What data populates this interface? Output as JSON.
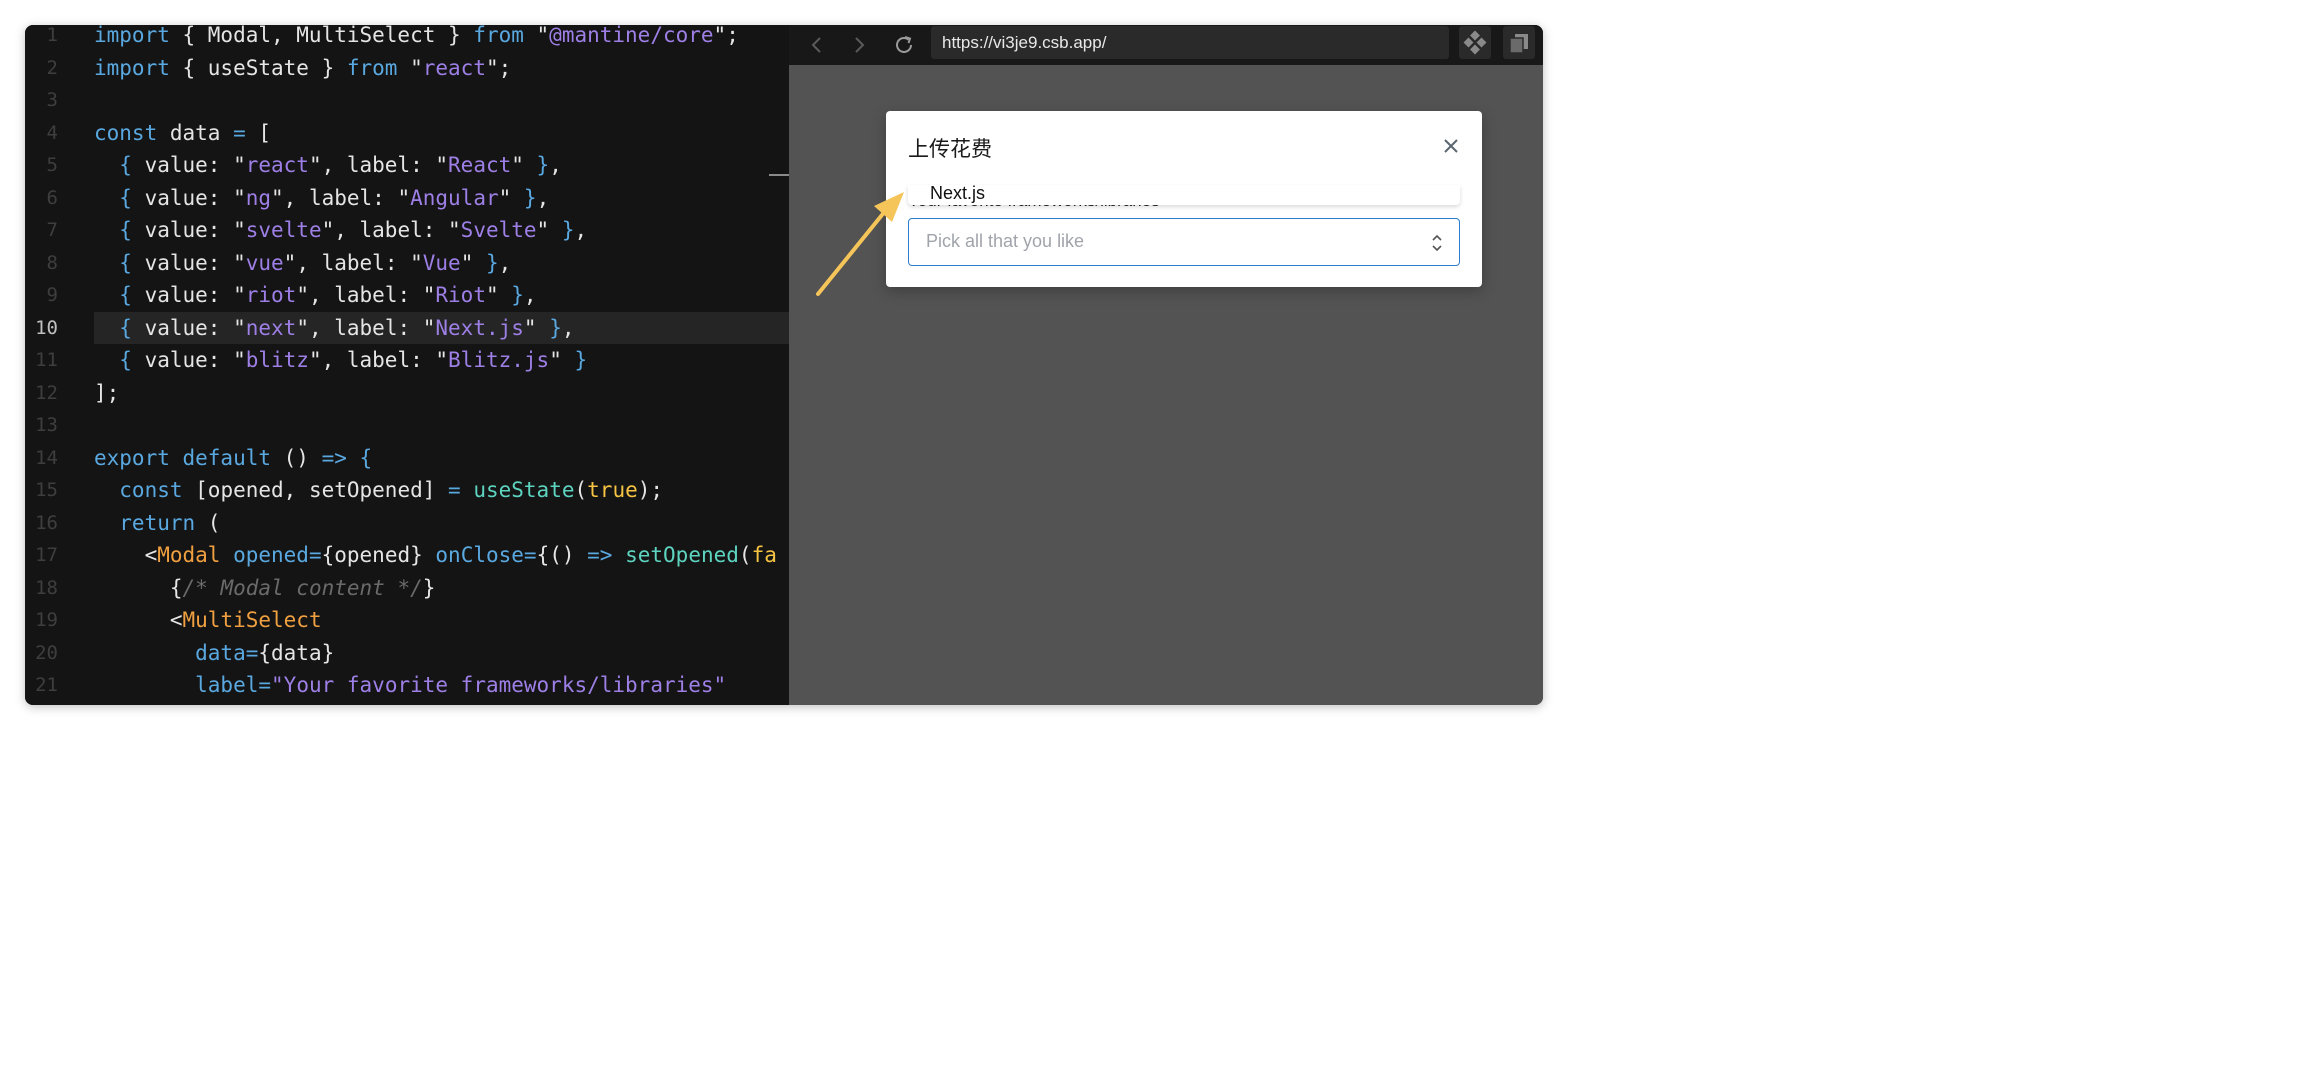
{
  "editor": {
    "active_line": 10,
    "lines": [
      {
        "n": "1",
        "tokens": [
          [
            "kw",
            "import"
          ],
          [
            "punc",
            " { Modal, MultiSelect } "
          ],
          [
            "kw",
            "from"
          ],
          [
            "punc",
            " \""
          ],
          [
            "str",
            "@mantine/core"
          ],
          [
            "punc",
            "\";"
          ]
        ]
      },
      {
        "n": "2",
        "tokens": [
          [
            "kw",
            "import"
          ],
          [
            "punc",
            " { useState } "
          ],
          [
            "kw",
            "from"
          ],
          [
            "punc",
            " \""
          ],
          [
            "str",
            "react"
          ],
          [
            "punc",
            "\";"
          ]
        ]
      },
      {
        "n": "3",
        "tokens": []
      },
      {
        "n": "4",
        "tokens": [
          [
            "kw",
            "const"
          ],
          [
            "punc",
            " data "
          ],
          [
            "kw",
            "="
          ],
          [
            "punc",
            " ["
          ]
        ]
      },
      {
        "n": "5",
        "tokens": [
          [
            "kw",
            "  {"
          ],
          [
            "punc",
            " value: \""
          ],
          [
            "str",
            "react"
          ],
          [
            "punc",
            "\", label: \""
          ],
          [
            "str",
            "React"
          ],
          [
            "punc",
            "\" "
          ],
          [
            "kw",
            "}"
          ],
          [
            "punc",
            ","
          ]
        ]
      },
      {
        "n": "6",
        "tokens": [
          [
            "kw",
            "  {"
          ],
          [
            "punc",
            " value: \""
          ],
          [
            "str",
            "ng"
          ],
          [
            "punc",
            "\", label: \""
          ],
          [
            "str",
            "Angular"
          ],
          [
            "punc",
            "\" "
          ],
          [
            "kw",
            "}"
          ],
          [
            "punc",
            ","
          ]
        ]
      },
      {
        "n": "7",
        "tokens": [
          [
            "kw",
            "  {"
          ],
          [
            "punc",
            " value: \""
          ],
          [
            "str",
            "svelte"
          ],
          [
            "punc",
            "\", label: \""
          ],
          [
            "str",
            "Svelte"
          ],
          [
            "punc",
            "\" "
          ],
          [
            "kw",
            "}"
          ],
          [
            "punc",
            ","
          ]
        ]
      },
      {
        "n": "8",
        "tokens": [
          [
            "kw",
            "  {"
          ],
          [
            "punc",
            " value: \""
          ],
          [
            "str",
            "vue"
          ],
          [
            "punc",
            "\", label: \""
          ],
          [
            "str",
            "Vue"
          ],
          [
            "punc",
            "\" "
          ],
          [
            "kw",
            "}"
          ],
          [
            "punc",
            ","
          ]
        ]
      },
      {
        "n": "9",
        "tokens": [
          [
            "kw",
            "  {"
          ],
          [
            "punc",
            " value: \""
          ],
          [
            "str",
            "riot"
          ],
          [
            "punc",
            "\", label: \""
          ],
          [
            "str",
            "Riot"
          ],
          [
            "punc",
            "\" "
          ],
          [
            "kw",
            "}"
          ],
          [
            "punc",
            ","
          ]
        ]
      },
      {
        "n": "10",
        "tokens": [
          [
            "kw",
            "  {"
          ],
          [
            "punc",
            " value: \""
          ],
          [
            "str",
            "next"
          ],
          [
            "punc",
            "\", label: \""
          ],
          [
            "str",
            "Next.js"
          ],
          [
            "punc",
            "\" "
          ],
          [
            "kw",
            "}"
          ],
          [
            "punc",
            ","
          ]
        ]
      },
      {
        "n": "11",
        "tokens": [
          [
            "kw",
            "  {"
          ],
          [
            "punc",
            " value: \""
          ],
          [
            "str",
            "blitz"
          ],
          [
            "punc",
            "\", label: \""
          ],
          [
            "str",
            "Blitz.js"
          ],
          [
            "punc",
            "\" "
          ],
          [
            "kw",
            "}"
          ]
        ]
      },
      {
        "n": "12",
        "tokens": [
          [
            "punc",
            "];"
          ]
        ]
      },
      {
        "n": "13",
        "tokens": []
      },
      {
        "n": "14",
        "tokens": [
          [
            "kw",
            "export default"
          ],
          [
            "punc",
            " () "
          ],
          [
            "kw",
            "=>"
          ],
          [
            "punc",
            " "
          ],
          [
            "kw",
            "{"
          ]
        ]
      },
      {
        "n": "15",
        "tokens": [
          [
            "kw",
            "  const"
          ],
          [
            "punc",
            " [opened, setOpened] "
          ],
          [
            "kw",
            "="
          ],
          [
            "punc",
            " "
          ],
          [
            "fn",
            "useState"
          ],
          [
            "punc",
            "("
          ],
          [
            "bool",
            "true"
          ],
          [
            "punc",
            ");"
          ]
        ]
      },
      {
        "n": "16",
        "tokens": [
          [
            "kw",
            "  return"
          ],
          [
            "punc",
            " ("
          ]
        ]
      },
      {
        "n": "17",
        "tokens": [
          [
            "punc",
            "    <"
          ],
          [
            "tag",
            "Modal"
          ],
          [
            "punc",
            " "
          ],
          [
            "attr",
            "opened"
          ],
          [
            "kw",
            "="
          ],
          [
            "punc",
            "{opened} "
          ],
          [
            "attr",
            "onClose"
          ],
          [
            "kw",
            "="
          ],
          [
            "punc",
            "{() "
          ],
          [
            "kw",
            "=>"
          ],
          [
            "punc",
            " "
          ],
          [
            "fn",
            "setOpened"
          ],
          [
            "punc",
            "("
          ],
          [
            "bool",
            "fa"
          ]
        ]
      },
      {
        "n": "18",
        "tokens": [
          [
            "punc",
            "      {"
          ],
          [
            "cmt",
            "/* Modal content */"
          ],
          [
            "punc",
            "}"
          ]
        ]
      },
      {
        "n": "19",
        "tokens": [
          [
            "punc",
            "      <"
          ],
          [
            "tag",
            "MultiSelect"
          ]
        ]
      },
      {
        "n": "20",
        "tokens": [
          [
            "attr",
            "        data"
          ],
          [
            "kw",
            "="
          ],
          [
            "punc",
            "{data}"
          ]
        ]
      },
      {
        "n": "21",
        "tokens": [
          [
            "attr",
            "        label"
          ],
          [
            "kw",
            "="
          ],
          [
            "str",
            "\"Your favorite frameworks/libraries\""
          ]
        ]
      }
    ]
  },
  "browser": {
    "back_icon": "chevron-left-icon",
    "forward_icon": "chevron-right-icon",
    "reload_icon": "reload-icon",
    "url": "https://vi3je9.csb.app/",
    "codesandbox_icon": "codesandbox-icon",
    "open_window_icon": "open-new-window-icon"
  },
  "modal": {
    "title": "上传花费",
    "close_icon": "close-icon",
    "field_label": "Your favorite frameworks/libraries",
    "dropdown_option": "Next.js",
    "placeholder": "Pick all that you like",
    "chevron_icon": "selector-chevron-icon"
  },
  "annotation": {
    "arrow_color": "#f6c55a"
  },
  "colors": {
    "editor_bg": "#141414",
    "browser_overlay": "#535353",
    "input_border": "#2f7dd1"
  }
}
